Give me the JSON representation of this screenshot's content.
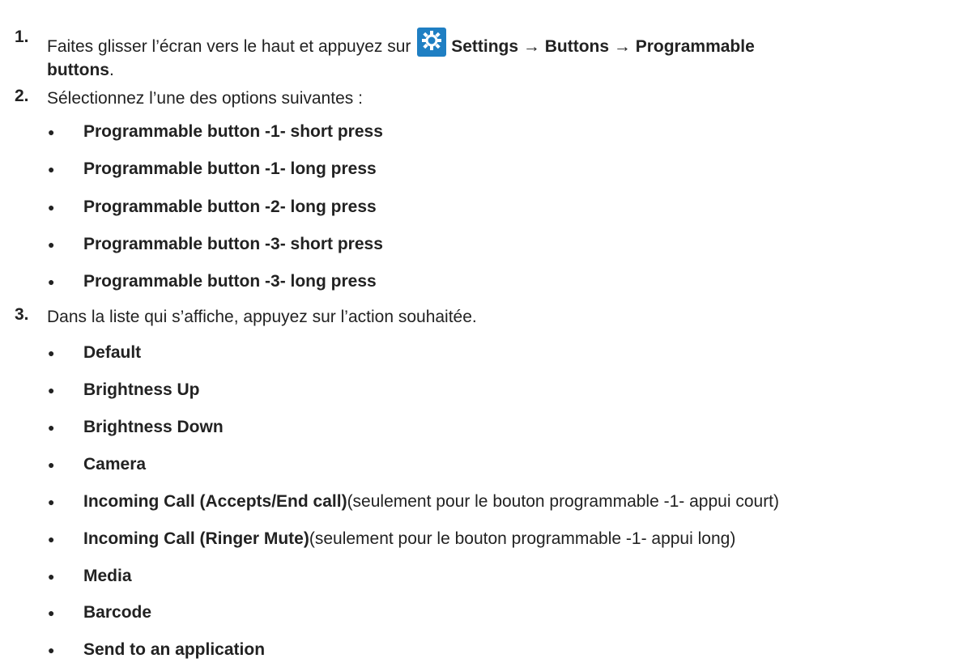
{
  "steps": [
    {
      "number": "1.",
      "text_before_icon": "Faites glisser l’écran vers le haut et appuyez sur ",
      "icon": "settings-gear-icon",
      "path_bold_line1": "Settings → Buttons → Programmable",
      "path_bold_line2": "buttons",
      "text_after": "."
    },
    {
      "number": "2.",
      "text": "Sélectionnez l’une des options suivantes :",
      "options": [
        "Programmable button -1- short press",
        "Programmable button -1- long press",
        "Programmable button -2- long press",
        "Programmable button -3- short press",
        "Programmable button -3- long press"
      ]
    },
    {
      "number": "3.",
      "text": "Dans la liste qui s’affiche, appuyez sur l’action souhaitée.",
      "actions": [
        {
          "bold": "Default",
          "note": ""
        },
        {
          "bold": "Brightness Up",
          "note": ""
        },
        {
          "bold": "Brightness Down",
          "note": ""
        },
        {
          "bold": "Camera",
          "note": ""
        },
        {
          "bold": "Incoming Call (Accepts/End call)",
          "note": "(seulement pour le bouton programmable -1- appui court)"
        },
        {
          "bold": "Incoming Call (Ringer Mute)",
          "note": "(seulement pour le bouton programmable -1- appui long)"
        },
        {
          "bold": "Media",
          "note": ""
        },
        {
          "bold": "Barcode",
          "note": ""
        },
        {
          "bold": "Send to an application",
          "note": ""
        }
      ]
    }
  ],
  "bullet_char": "●",
  "colors": {
    "text": "#222222",
    "icon_bg": "#1f7fc3",
    "icon_fg": "#ffffff"
  }
}
